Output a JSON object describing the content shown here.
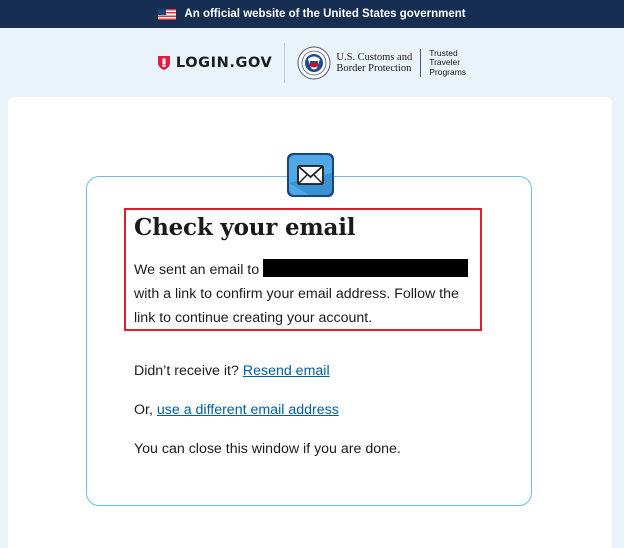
{
  "banner": {
    "text": "An official website of the United States government"
  },
  "header": {
    "logo_text": "LOGIN.GOV",
    "partner_name_line1": "U.S. Customs and",
    "partner_name_line2": "Border Protection",
    "program_line1": "Trusted",
    "program_line2": "Traveler",
    "program_line3": "Programs"
  },
  "main": {
    "title": "Check your email",
    "sent_prefix": "We sent an email to",
    "sent_suffix": "with a link to confirm your email address. Follow the link to continue creating your account.",
    "resend_prefix": "Didn’t receive it?",
    "resend_link": "Resend email",
    "different_prefix": "Or,",
    "different_link": "use a different email address",
    "close_text": "You can close this window if you are done."
  },
  "colors": {
    "banner_bg": "#162e51",
    "page_bg": "#eaf2fa",
    "card_border": "#6bc1de",
    "link": "#005ea2",
    "highlight": "#e21c2a",
    "brand_red": "#e21c3d"
  }
}
